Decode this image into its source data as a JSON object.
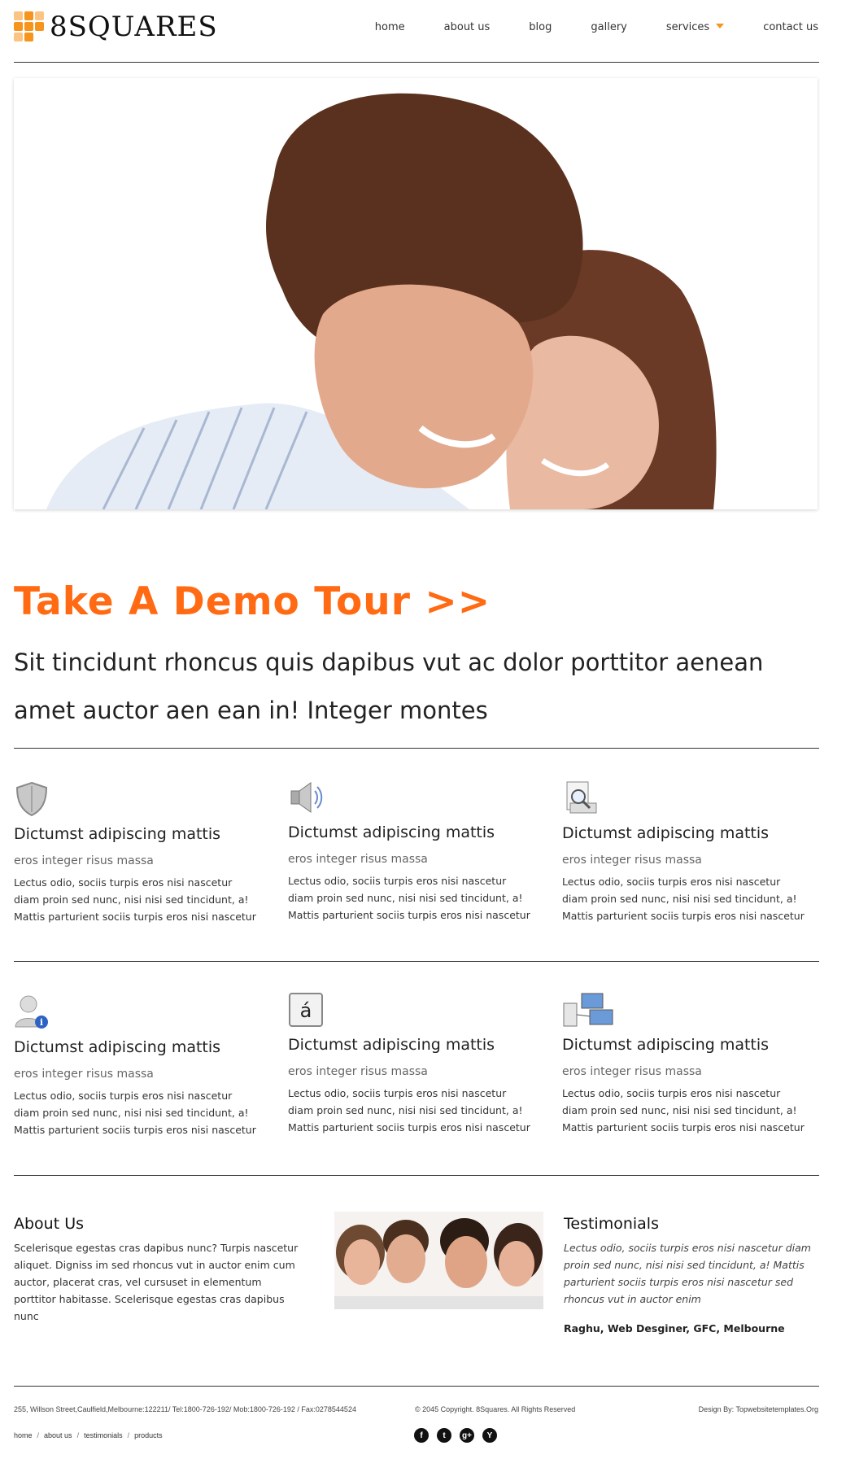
{
  "header": {
    "logo_text": "8SQUARES",
    "nav": [
      {
        "label": "home"
      },
      {
        "label": "about us"
      },
      {
        "label": "blog"
      },
      {
        "label": "gallery"
      },
      {
        "label": "services",
        "has_dropdown": true
      },
      {
        "label": "contact us"
      }
    ],
    "accent": "#f7941d"
  },
  "hero": {
    "image": "couple-smiling-photo"
  },
  "demo": {
    "title": "Take A Demo Tour >>",
    "lead": "Sit tincidunt rhoncus quis dapibus vut ac dolor porttitor aenean amet auctor aen ean in! Integer montes",
    "color": "#ff6a13"
  },
  "features": [
    {
      "icon": "shield-icon",
      "title": "Dictumst adipiscing mattis",
      "subtitle": "eros integer risus massa",
      "text": "Lectus odio, sociis turpis eros nisi nascetur diam proin sed nunc, nisi nisi sed tincidunt, a! Mattis parturient sociis turpis eros nisi nascetur"
    },
    {
      "icon": "speaker-icon",
      "title": "Dictumst adipiscing mattis",
      "subtitle": "eros integer risus massa",
      "text": "Lectus odio, sociis turpis eros nisi nascetur diam proin sed nunc, nisi nisi sed tincidunt, a! Mattis parturient sociis turpis eros nisi nascetur"
    },
    {
      "icon": "search-document-icon",
      "title": "Dictumst adipiscing mattis",
      "subtitle": "eros integer risus massa",
      "text": "Lectus odio, sociis turpis eros nisi nascetur diam proin sed nunc, nisi nisi sed tincidunt, a! Mattis parturient sociis turpis eros nisi nascetur"
    },
    {
      "icon": "user-info-icon",
      "title": "Dictumst adipiscing mattis",
      "subtitle": "eros integer risus massa",
      "text": "Lectus odio, sociis turpis eros nisi nascetur diam proin sed nunc, nisi nisi sed tincidunt, a! Mattis parturient sociis turpis eros nisi nascetur"
    },
    {
      "icon": "character-key-icon",
      "glyph": "á",
      "title": "Dictumst adipiscing mattis",
      "subtitle": "eros integer risus massa",
      "text": "Lectus odio, sociis turpis eros nisi nascetur diam proin sed nunc, nisi nisi sed tincidunt, a! Mattis parturient sociis turpis eros nisi nascetur"
    },
    {
      "icon": "network-computers-icon",
      "title": "Dictumst adipiscing mattis",
      "subtitle": "eros integer risus massa",
      "text": "Lectus odio, sociis turpis eros nisi nascetur diam proin sed nunc, nisi nisi sed tincidunt, a! Mattis parturient sociis turpis eros nisi nascetur"
    }
  ],
  "about": {
    "title": "About Us",
    "text": "Scelerisque egestas cras dapibus nunc? Turpis nascetur aliquet. Digniss im sed rhoncus vut in auctor enim cum auctor, placerat cras, vel cursuset in elementum porttitor habitasse. Scelerisque egestas cras dapibus nunc"
  },
  "group_image": "group-of-four-people-photo",
  "testimonials": {
    "title": "Testimonials",
    "quote": "Lectus odio, sociis turpis eros nisi nascetur diam proin sed nunc, nisi nisi sed tincidunt, a! Mattis parturient sociis turpis eros nisi nascetur sed rhoncus vut in auctor enim",
    "author": "Raghu, Web Desginer, GFC, Melbourne"
  },
  "footer": {
    "address": "255, Willson Street,Caulfield,Melbourne:122211/ Tel:1800-726-192/ Mob:1800-726-192 / Fax:0278544524",
    "copyright": "© 2045 Copyright. 8Squares. All Rights Reserved",
    "design": "Design By: Topwebsitetemplates.Org",
    "links": [
      "home",
      "about us",
      "testimonials",
      "products"
    ],
    "social": [
      {
        "icon": "facebook-icon",
        "glyph": "f"
      },
      {
        "icon": "twitter-icon",
        "glyph": "t"
      },
      {
        "icon": "google-plus-icon",
        "glyph": "g+"
      },
      {
        "icon": "yahoo-icon",
        "glyph": "Y"
      }
    ]
  }
}
